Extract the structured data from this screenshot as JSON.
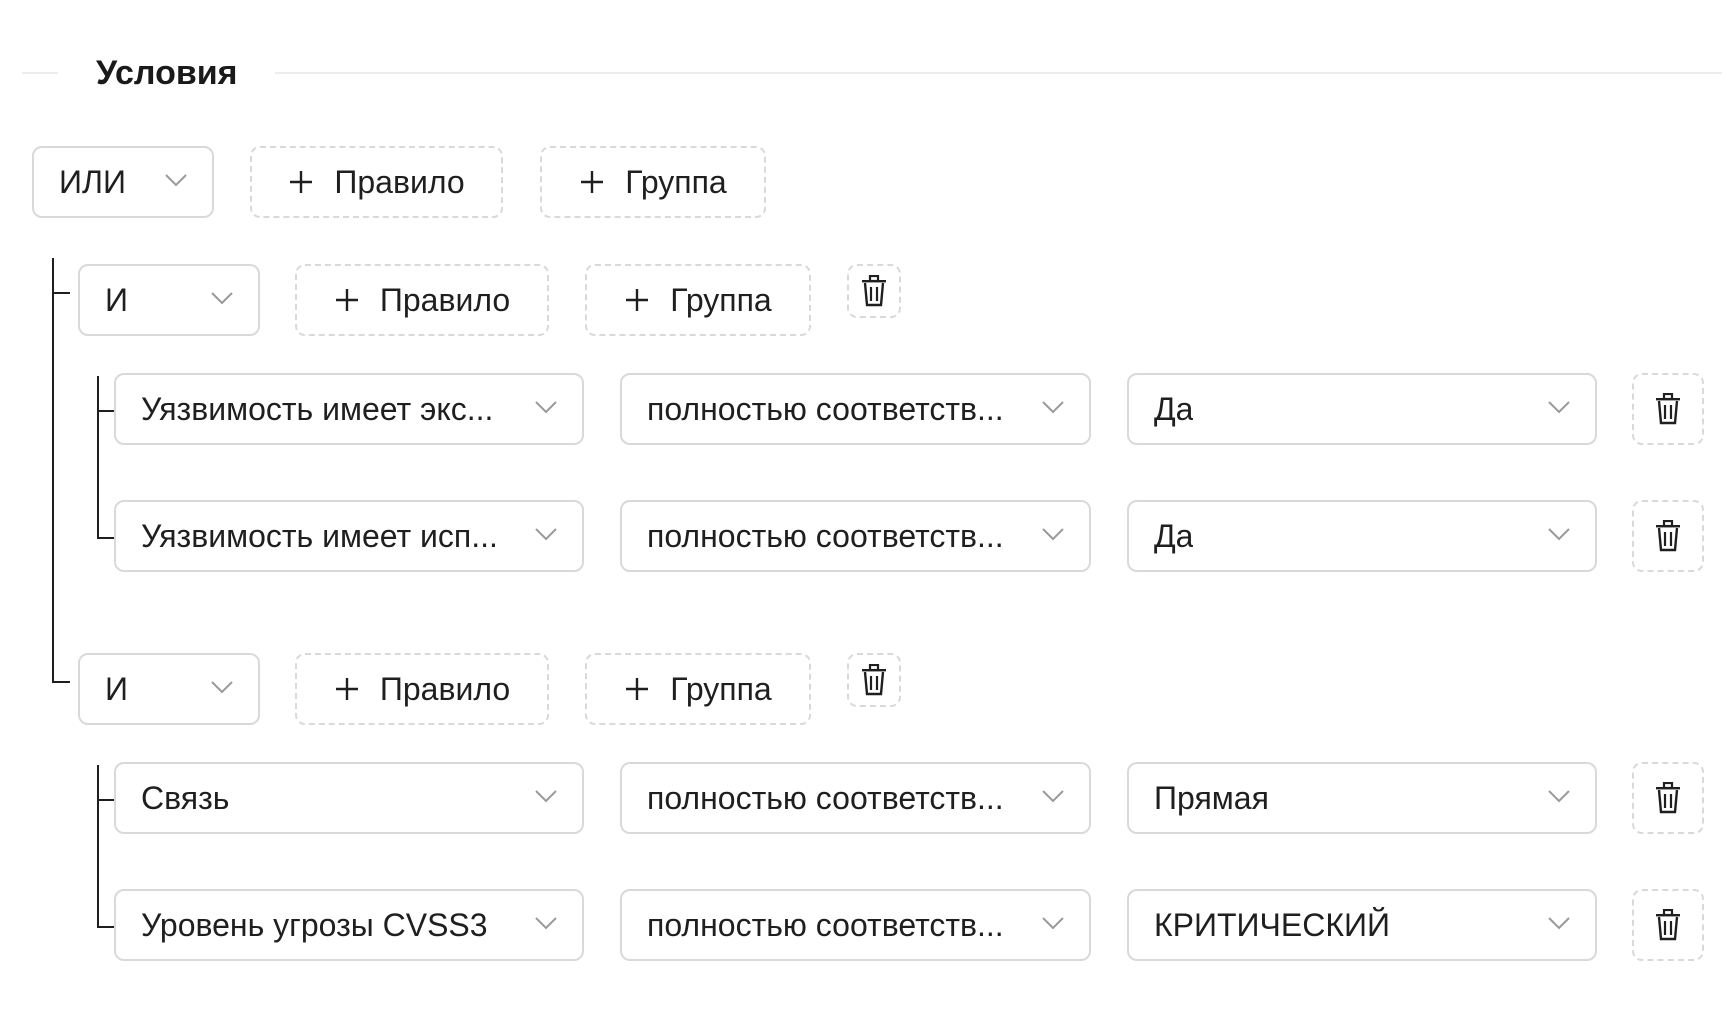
{
  "section": {
    "title": "Условия"
  },
  "root": {
    "combinator": "ИЛИ",
    "add_rule_label": "Правило",
    "add_group_label": "Группа"
  },
  "groups": [
    {
      "combinator": "И",
      "add_rule_label": "Правило",
      "add_group_label": "Группа",
      "rules": [
        {
          "field": "Уязвимость имеет экс...",
          "operator": "полностью соответств...",
          "value": "Да"
        },
        {
          "field": "Уязвимость имеет исп...",
          "operator": "полностью соответств...",
          "value": "Да"
        }
      ]
    },
    {
      "combinator": "И",
      "add_rule_label": "Правило",
      "add_group_label": "Группа",
      "rules": [
        {
          "field": "Связь",
          "operator": "полностью соответств...",
          "value": "Прямая"
        },
        {
          "field": "Уровень угрозы CVSS3",
          "operator": "полностью соответств...",
          "value": "КРИТИЧЕСКИЙ"
        }
      ]
    }
  ],
  "icons": {
    "chevron": "chevron-down-icon",
    "plus": "plus-icon",
    "delete": "trash-icon"
  },
  "colors": {
    "border": "#d9d9d9",
    "text": "#1f1f1f",
    "divider": "#ececec"
  }
}
